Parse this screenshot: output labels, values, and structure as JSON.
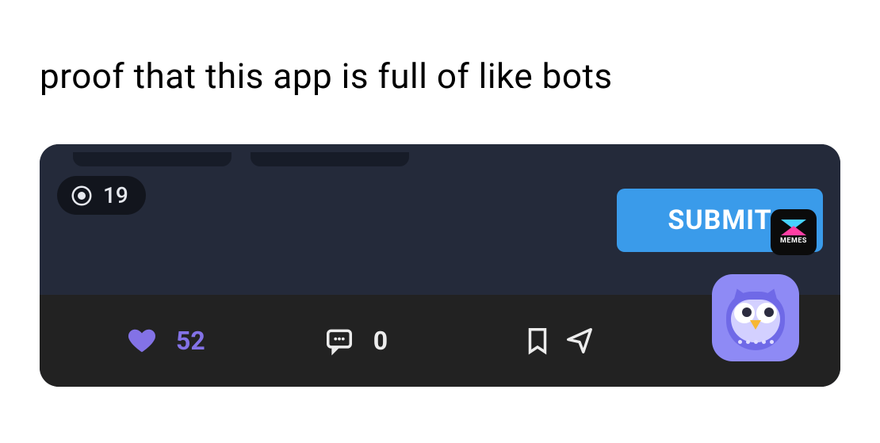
{
  "caption": "proof that this app is full of like bots",
  "embedded": {
    "views_count": "19",
    "submit_label": "SUBMIT",
    "memes_label": "MEMES",
    "like_count": "52",
    "comment_count": "0"
  },
  "icons": {
    "eye": "eye-icon",
    "heart": "heart-icon",
    "comment": "comment-icon",
    "bookmark": "bookmark-icon",
    "share": "share-icon"
  },
  "colors": {
    "accent_like": "#8372e6",
    "submit_bg": "#3a9bea",
    "owl_bg": "#8e8af5"
  }
}
